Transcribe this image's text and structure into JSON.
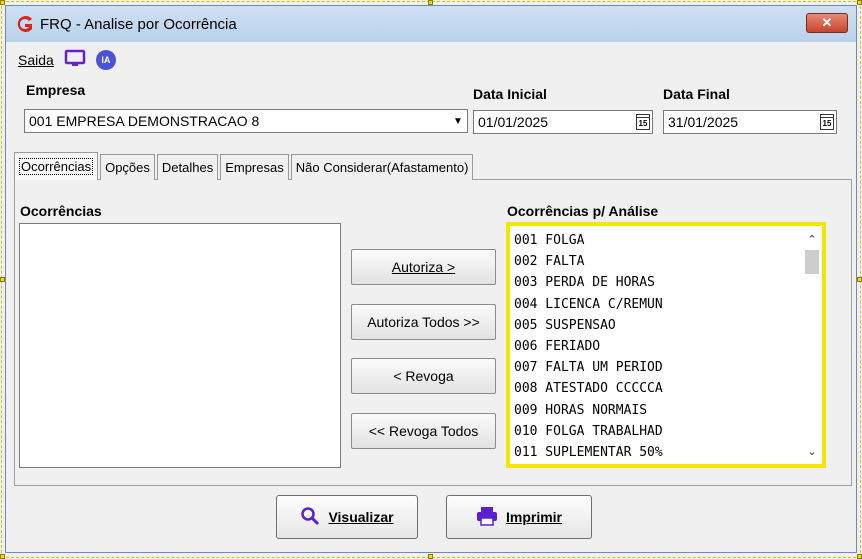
{
  "window": {
    "title": "FRQ - Analise por Ocorrência",
    "close_label": "✕"
  },
  "menu": {
    "saida_label": "Saida",
    "ia_label": "IA"
  },
  "form": {
    "empresa_label": "Empresa",
    "empresa_value": "001 EMPRESA DEMONSTRACAO 8",
    "data_inicial_label": "Data Inicial",
    "data_inicial_value": "01/01/2025",
    "data_final_label": "Data Final",
    "data_final_value": "31/01/2025",
    "calendar_icon_text": "15"
  },
  "tabs": [
    {
      "label": "Ocorrências",
      "active": true
    },
    {
      "label": "Opções"
    },
    {
      "label": "Detalhes"
    },
    {
      "label": "Empresas"
    },
    {
      "label": "Não Considerar(Afastamento)"
    }
  ],
  "ocorrencias": {
    "label": "Ocorrências",
    "items": []
  },
  "buttons": {
    "autoriza": "Autoriza >",
    "autoriza_todos": "Autoriza Todos >>",
    "revoga": "< Revoga",
    "revoga_todos": "<< Revoga Todos"
  },
  "analise": {
    "label": "Ocorrências p/ Análise",
    "items": [
      "001 FOLGA",
      "002 FALTA",
      "003 PERDA DE HORAS",
      "004 LICENCA C/REMUN",
      "005 SUSPENSAO",
      "006 FERIADO",
      "007 FALTA UM PERIOD",
      "008 ATESTADO CCCCCA",
      "009 HORAS NORMAIS",
      "010 FOLGA TRABALHAD",
      "011 SUPLEMENTAR 50%"
    ]
  },
  "footer": {
    "visualizar": "Visualizar",
    "imprimir": "Imprimir"
  },
  "colors": {
    "highlight": "#f5e600",
    "ia_badge": "#4a52d8",
    "logo_red": "#d9261c",
    "monitor_purple": "#6a1fd0"
  }
}
